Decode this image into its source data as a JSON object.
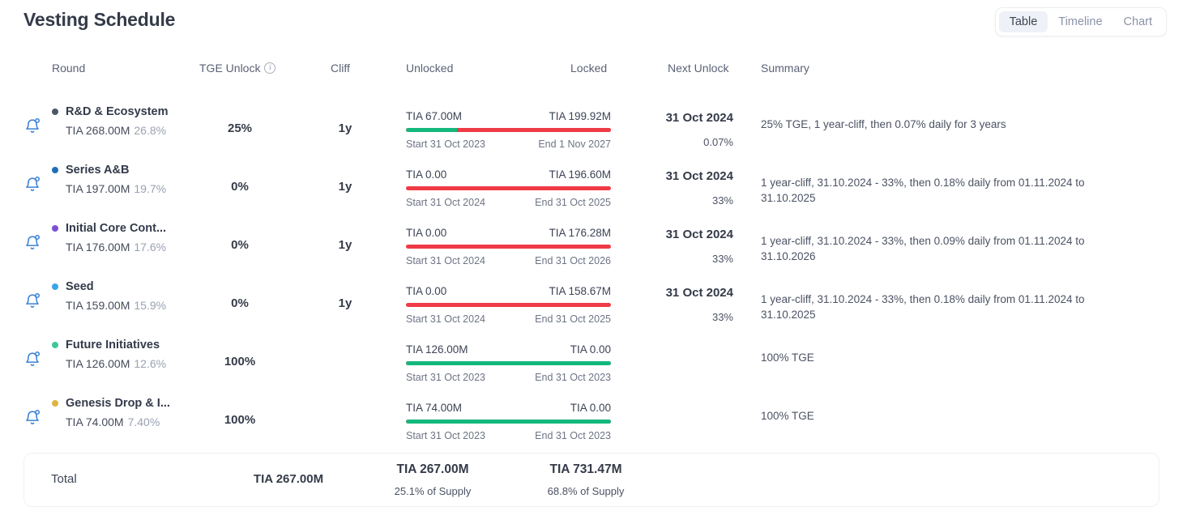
{
  "header": {
    "title": "Vesting Schedule",
    "view_toggle": {
      "options": [
        "Table",
        "Timeline",
        "Chart"
      ],
      "selected": "Table"
    }
  },
  "table": {
    "columns": {
      "round": "Round",
      "tge_unlock": "TGE Unlock",
      "tge_unlock_icon": "info-icon",
      "cliff": "Cliff",
      "unlocked": "Unlocked",
      "locked": "Locked",
      "next_unlock": "Next Unlock",
      "summary": "Summary"
    },
    "rows": [
      {
        "icon": "bell-notification-icon",
        "dot_color": "#4e5668",
        "name": "R&D & Ecosystem",
        "amount": "TIA 268.00M",
        "share": "26.8%",
        "tge_unlock": "25%",
        "cliff": "1y",
        "unlocked": "TIA 67.00M",
        "locked": "TIA 199.92M",
        "unlocked_ratio": 25,
        "start": "Start 31 Oct 2023",
        "end": "End 1 Nov 2027",
        "next_unlock_date": "31 Oct 2024",
        "next_unlock_pct": "0.07%",
        "summary": "25% TGE, 1 year-cliff, then 0.07% daily for 3 years"
      },
      {
        "icon": "bell-notification-icon",
        "dot_color": "#1f6fb5",
        "name": "Series A&B",
        "amount": "TIA 197.00M",
        "share": "19.7%",
        "tge_unlock": "0%",
        "cliff": "1y",
        "unlocked": "TIA 0.00",
        "locked": "TIA 196.60M",
        "unlocked_ratio": 0,
        "start": "Start 31 Oct 2024",
        "end": "End 31 Oct 2025",
        "next_unlock_date": "31 Oct 2024",
        "next_unlock_pct": "33%",
        "summary": "1 year-cliff, 31.10.2024 - 33%, then 0.18% daily from 01.11.2024 to 31.10.2025"
      },
      {
        "icon": "bell-notification-icon",
        "dot_color": "#7c4fd4",
        "name": "Initial Core Cont...",
        "amount": "TIA 176.00M",
        "share": "17.6%",
        "tge_unlock": "0%",
        "cliff": "1y",
        "unlocked": "TIA 0.00",
        "locked": "TIA 176.28M",
        "unlocked_ratio": 0,
        "start": "Start 31 Oct 2024",
        "end": "End 31 Oct 2026",
        "next_unlock_date": "31 Oct 2024",
        "next_unlock_pct": "33%",
        "summary": "1 year-cliff, 31.10.2024 - 33%, then 0.09% daily from 01.11.2024 to 31.10.2026"
      },
      {
        "icon": "bell-notification-icon",
        "dot_color": "#3aa5e8",
        "name": "Seed",
        "amount": "TIA 159.00M",
        "share": "15.9%",
        "tge_unlock": "0%",
        "cliff": "1y",
        "unlocked": "TIA 0.00",
        "locked": "TIA 158.67M",
        "unlocked_ratio": 0,
        "start": "Start 31 Oct 2024",
        "end": "End 31 Oct 2025",
        "next_unlock_date": "31 Oct 2024",
        "next_unlock_pct": "33%",
        "summary": "1 year-cliff, 31.10.2024 - 33%, then 0.18% daily from 01.11.2024 to 31.10.2025"
      },
      {
        "icon": "bell-notification-icon",
        "dot_color": "#3ec79a",
        "name": "Future Initiatives",
        "amount": "TIA 126.00M",
        "share": "12.6%",
        "tge_unlock": "100%",
        "cliff": "",
        "unlocked": "TIA 126.00M",
        "locked": "TIA 0.00",
        "unlocked_ratio": 100,
        "start": "Start 31 Oct 2023",
        "end": "End 31 Oct 2023",
        "next_unlock_date": "",
        "next_unlock_pct": "",
        "summary": "100% TGE"
      },
      {
        "icon": "bell-notification-icon",
        "dot_color": "#dcb440",
        "name": "Genesis Drop & I...",
        "amount": "TIA 74.00M",
        "share": "7.40%",
        "tge_unlock": "100%",
        "cliff": "",
        "unlocked": "TIA 74.00M",
        "locked": "TIA 0.00",
        "unlocked_ratio": 100,
        "start": "Start 31 Oct 2023",
        "end": "End 31 Oct 2023",
        "next_unlock_date": "",
        "next_unlock_pct": "",
        "summary": "100% TGE"
      }
    ],
    "total": {
      "label": "Total",
      "tge_unlock": "TIA 267.00M",
      "unlocked": "TIA 267.00M",
      "unlocked_sub": "25.1% of Supply",
      "locked": "TIA 731.47M",
      "locked_sub": "68.8% of Supply"
    }
  },
  "colors": {
    "unlocked_bar": "#14b87c",
    "locked_bar": "#ef3b46",
    "segment_active_bg": "#eef1f7",
    "bell_icon": "#3b82d6"
  }
}
